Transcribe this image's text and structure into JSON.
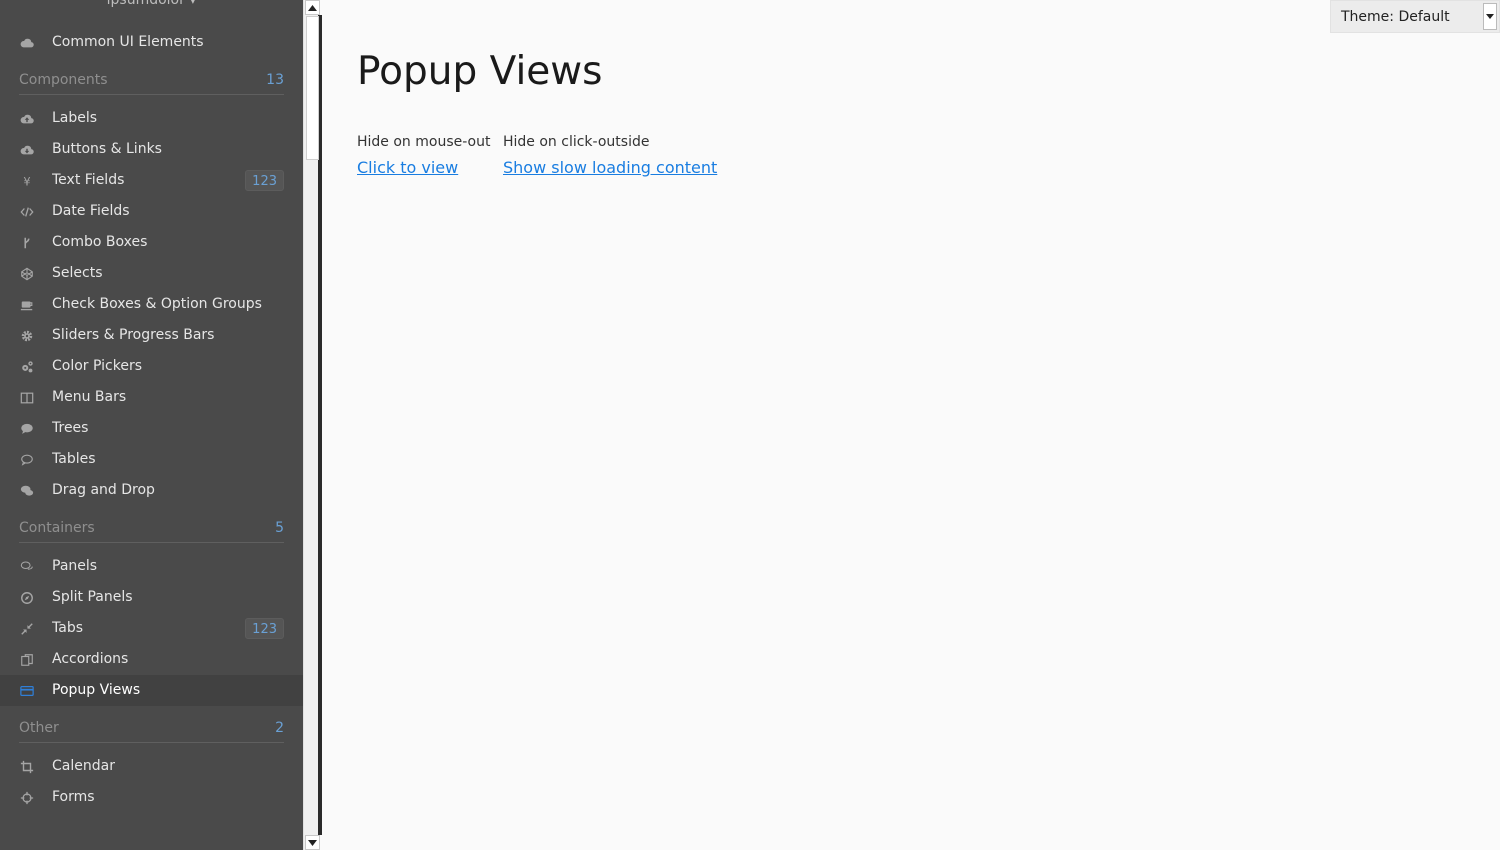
{
  "sidebar": {
    "user_menu": "ipsumdolor",
    "top_item": {
      "label": "Common UI Elements",
      "icon": "cloud-icon"
    },
    "sections": [
      {
        "title": "Components",
        "count": "13"
      },
      {
        "title": "Containers",
        "count": "5"
      },
      {
        "title": "Other",
        "count": "2"
      }
    ],
    "components": [
      {
        "label": "Labels",
        "icon": "cloud-upload-icon"
      },
      {
        "label": "Buttons & Links",
        "icon": "cloud-download-icon"
      },
      {
        "label": "Text Fields",
        "icon": "yen-icon",
        "badge": "123"
      },
      {
        "label": "Date Fields",
        "icon": "code-icon"
      },
      {
        "label": "Combo Boxes",
        "icon": "fork-icon"
      },
      {
        "label": "Selects",
        "icon": "codepen-icon"
      },
      {
        "label": "Check Boxes & Option Groups",
        "icon": "coffee-icon"
      },
      {
        "label": "Sliders & Progress Bars",
        "icon": "cog-icon"
      },
      {
        "label": "Color Pickers",
        "icon": "cogs-icon"
      },
      {
        "label": "Menu Bars",
        "icon": "columns-icon"
      },
      {
        "label": "Trees",
        "icon": "comment-icon"
      },
      {
        "label": "Tables",
        "icon": "comment-outline-icon"
      },
      {
        "label": "Drag and Drop",
        "icon": "comments-icon"
      }
    ],
    "containers": [
      {
        "label": "Panels",
        "icon": "comments-outline-icon"
      },
      {
        "label": "Split Panels",
        "icon": "compass-icon"
      },
      {
        "label": "Tabs",
        "icon": "compress-icon",
        "badge": "123"
      },
      {
        "label": "Accordions",
        "icon": "copy-icon"
      },
      {
        "label": "Popup Views",
        "icon": "credit-card-icon",
        "selected": true
      }
    ],
    "other": [
      {
        "label": "Calendar",
        "icon": "crop-icon"
      },
      {
        "label": "Forms",
        "icon": "crosshairs-icon"
      }
    ]
  },
  "main": {
    "title": "Popup Views",
    "popups": [
      {
        "caption": "Hide on mouse-out",
        "link": "Click to view"
      },
      {
        "caption": "Hide on click-outside",
        "link": "Show slow loading content"
      }
    ]
  },
  "theme_select": {
    "value": "Theme: Default"
  },
  "colors": {
    "sidebar_bg": "#4a4a4a",
    "accent": "#197de1",
    "badge_text": "#6aa0d4",
    "page_bg": "#fafafa"
  }
}
